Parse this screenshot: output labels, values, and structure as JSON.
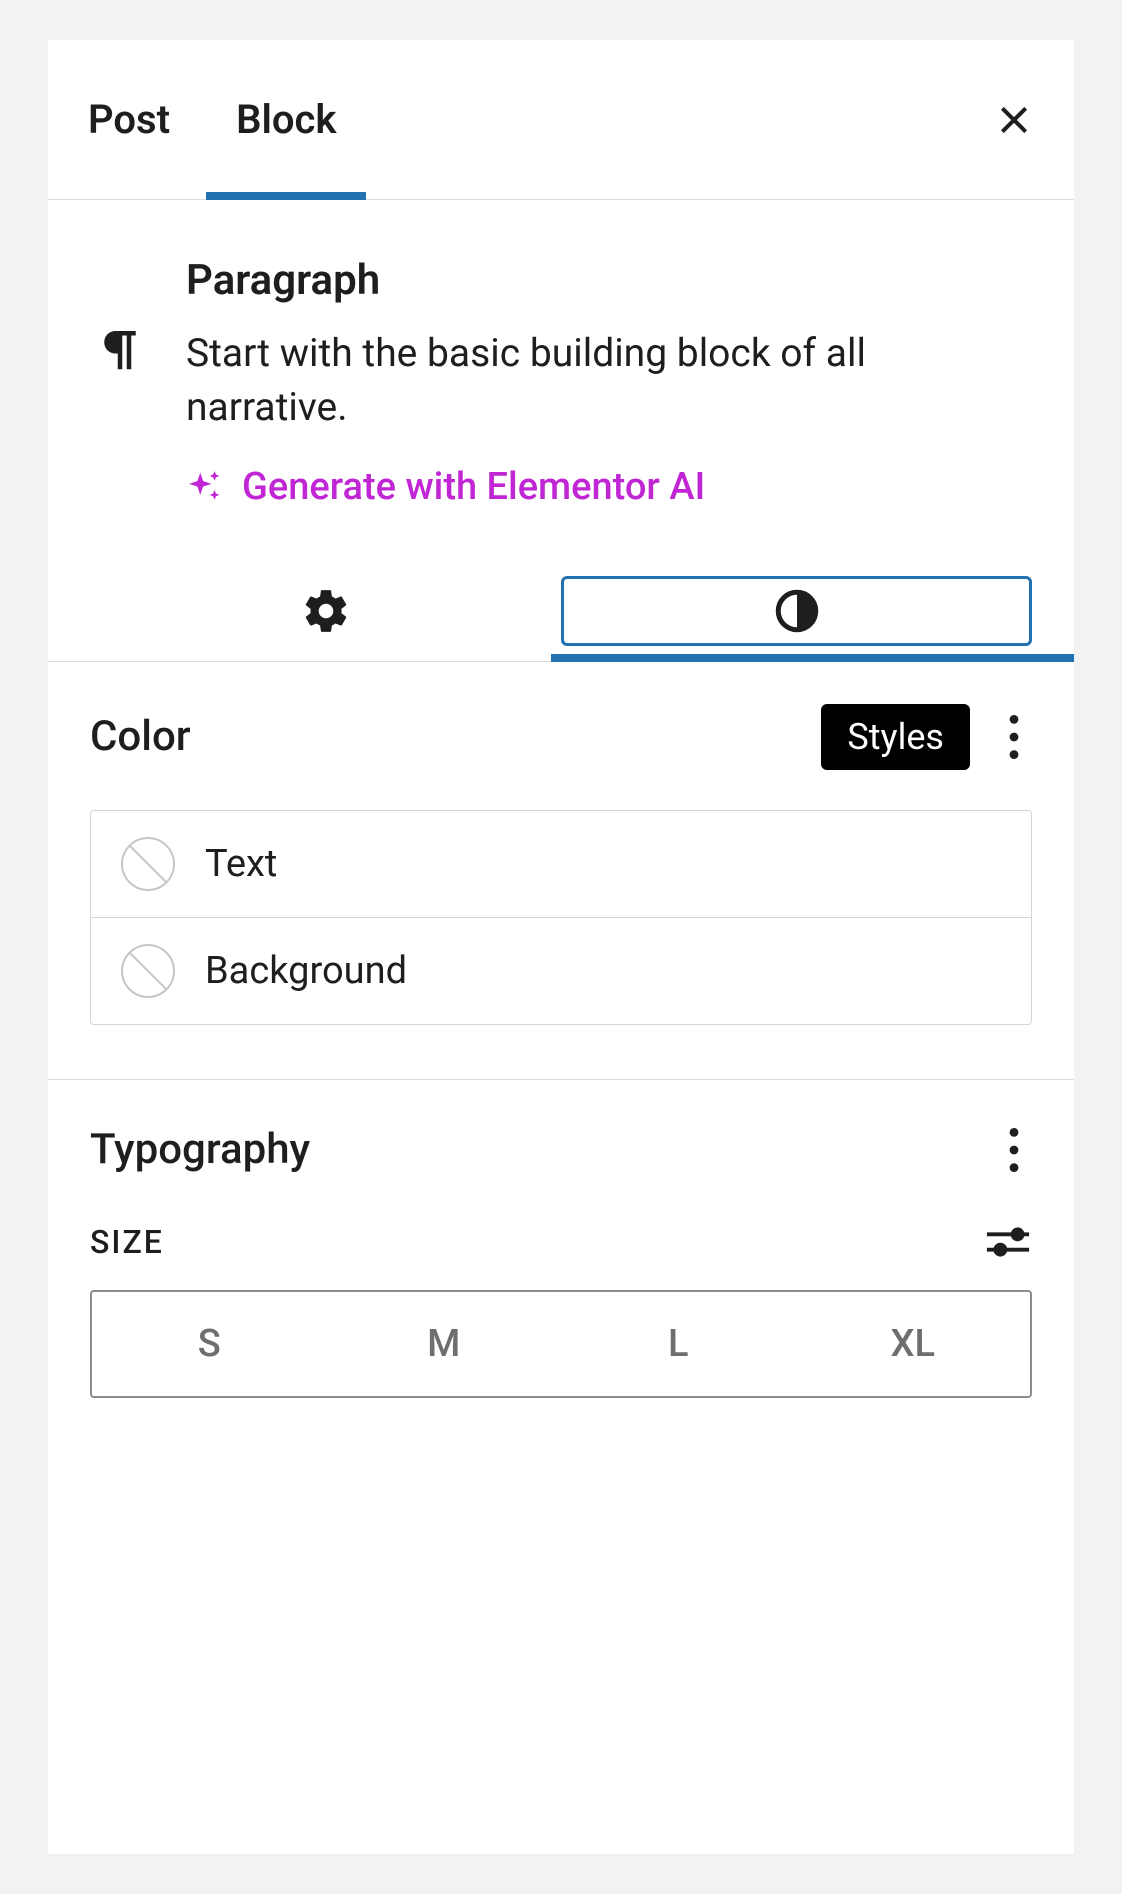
{
  "tabs": {
    "post": "Post",
    "block": "Block"
  },
  "block": {
    "name": "Paragraph",
    "description": "Start with the basic building block of all narrative.",
    "ai_link": "Generate with Elementor AI"
  },
  "tooltip_styles": "Styles",
  "sections": {
    "color": {
      "title": "Color",
      "rows": {
        "text": "Text",
        "background": "Background"
      }
    },
    "typography": {
      "title": "Typography",
      "size_label": "SIZE",
      "sizes": [
        "S",
        "M",
        "L",
        "XL"
      ]
    }
  }
}
